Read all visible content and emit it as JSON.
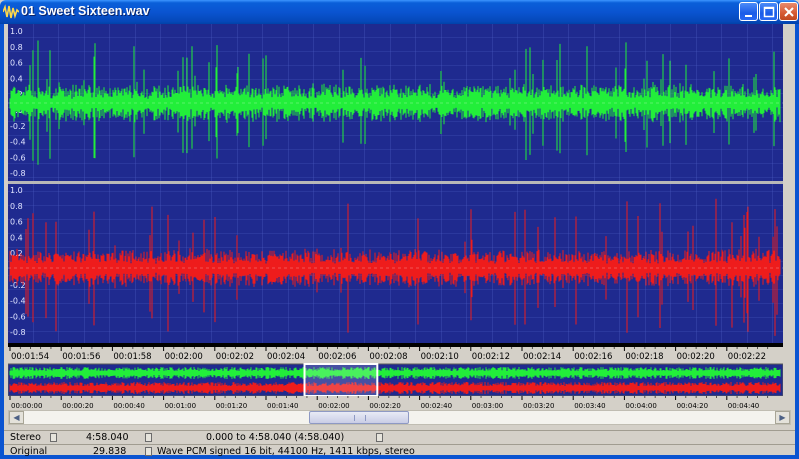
{
  "window": {
    "title": "01 Sweet Sixteen.wav",
    "buttons": [
      "minimize",
      "maximize",
      "close"
    ]
  },
  "colors": {
    "background": "#1f2a8f",
    "grid": "#4f61c8",
    "channel_left": "#22ee3a",
    "channel_right": "#ee1c1c",
    "timeline": "#d4d0c8"
  },
  "amplitude_axis": {
    "top_channel_labels": [
      "1.0",
      "0.8",
      "0.6",
      "0.4",
      "0.2",
      "0.0",
      "-0.2",
      "-0.4",
      "-0.6",
      "-0.8"
    ],
    "bottom_channel_labels": [
      "1.0",
      "0.8",
      "0.6",
      "0.4",
      "0.2",
      "0.0",
      "-0.2",
      "-0.4",
      "-0.6",
      "-0.8"
    ]
  },
  "zoomed_timeline": {
    "labels": [
      "00:01:54",
      "00:01:56",
      "00:01:58",
      "00:02:00",
      "00:02:02",
      "00:02:04",
      "00:02:06",
      "00:02:08",
      "00:02:10",
      "00:02:12",
      "00:02:14",
      "00:02:16",
      "00:02:18",
      "00:02:20",
      "00:02:22"
    ]
  },
  "overview_timeline": {
    "labels": [
      "00:00:00",
      "00:00:20",
      "00:00:40",
      "00:01:00",
      "00:01:20",
      "00:01:40",
      "00:02:00",
      "00:02:20",
      "00:02:40",
      "00:03:00",
      "00:03:20",
      "00:03:40",
      "00:04:00",
      "00:04:20",
      "00:04:40"
    ],
    "selection_start_seconds": 114,
    "selection_end_seconds": 142
  },
  "status": {
    "channels": "Stereo",
    "length": "4:58.040",
    "selection": "0.000 to 4:58.040 (4:58.040)",
    "mode": "Original",
    "size": "29.838",
    "format": "Wave PCM signed 16 bit, 44100 Hz, 1411 kbps, stereo"
  }
}
